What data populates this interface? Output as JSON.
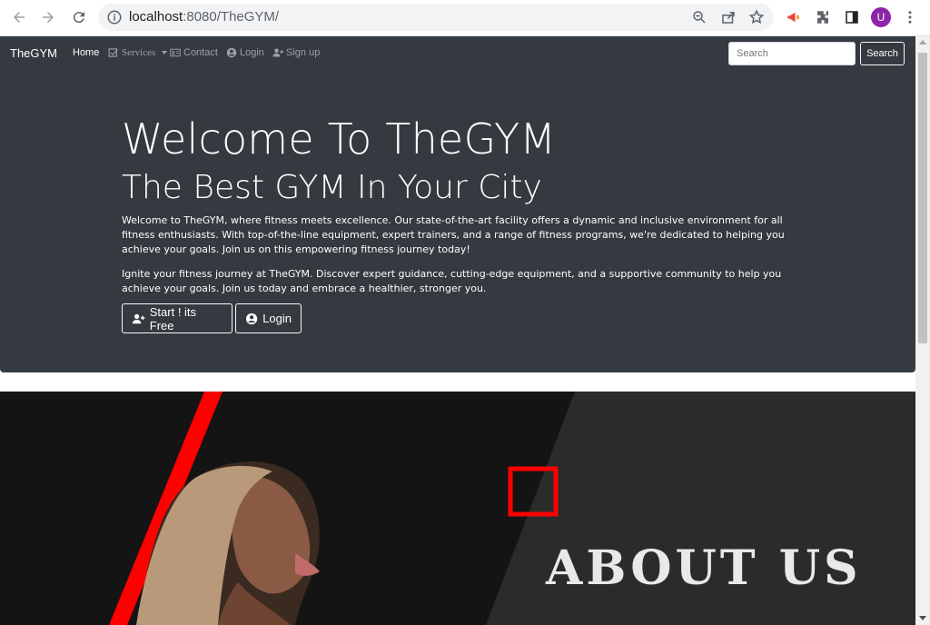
{
  "browser": {
    "url_host": "localhost",
    "url_port_path": ":8080/TheGYM/",
    "avatar_letter": "U"
  },
  "navbar": {
    "brand": "TheGYM",
    "items": [
      {
        "label": "Home",
        "icon": "",
        "active": true
      },
      {
        "label": "Services",
        "icon": "checkbox-icon",
        "active": false
      },
      {
        "label": "Contact",
        "icon": "contact-card-icon",
        "active": false
      },
      {
        "label": "Login",
        "icon": "user-circle-icon",
        "active": false
      },
      {
        "label": "Sign up",
        "icon": "user-plus-icon",
        "active": false
      }
    ],
    "search_placeholder": "Search",
    "search_button": "Search"
  },
  "hero": {
    "title": "Welcome To TheGYM",
    "subtitle": "The Best GYM In Your City",
    "paragraph1": "Welcome to TheGYM, where fitness meets excellence. Our state-of-the-art facility offers a dynamic and inclusive environment for all fitness enthusiasts. With top-of-the-line equipment, expert trainers, and a range of fitness programs, we're dedicated to helping you achieve your goals. Join us on this empowering fitness journey today!",
    "paragraph2": "Ignite your fitness journey at TheGYM. Discover expert guidance, cutting-edge equipment, and a supportive community to help you achieve your goals. Join us today and embrace a healthier, stronger you.",
    "start_button": "Start ! its Free",
    "login_button": "Login"
  },
  "about": {
    "title": "ABOUT US"
  },
  "colors": {
    "navbar_bg": "#343a40",
    "about_bg": "#252525",
    "accent_red": "#ff0000"
  }
}
